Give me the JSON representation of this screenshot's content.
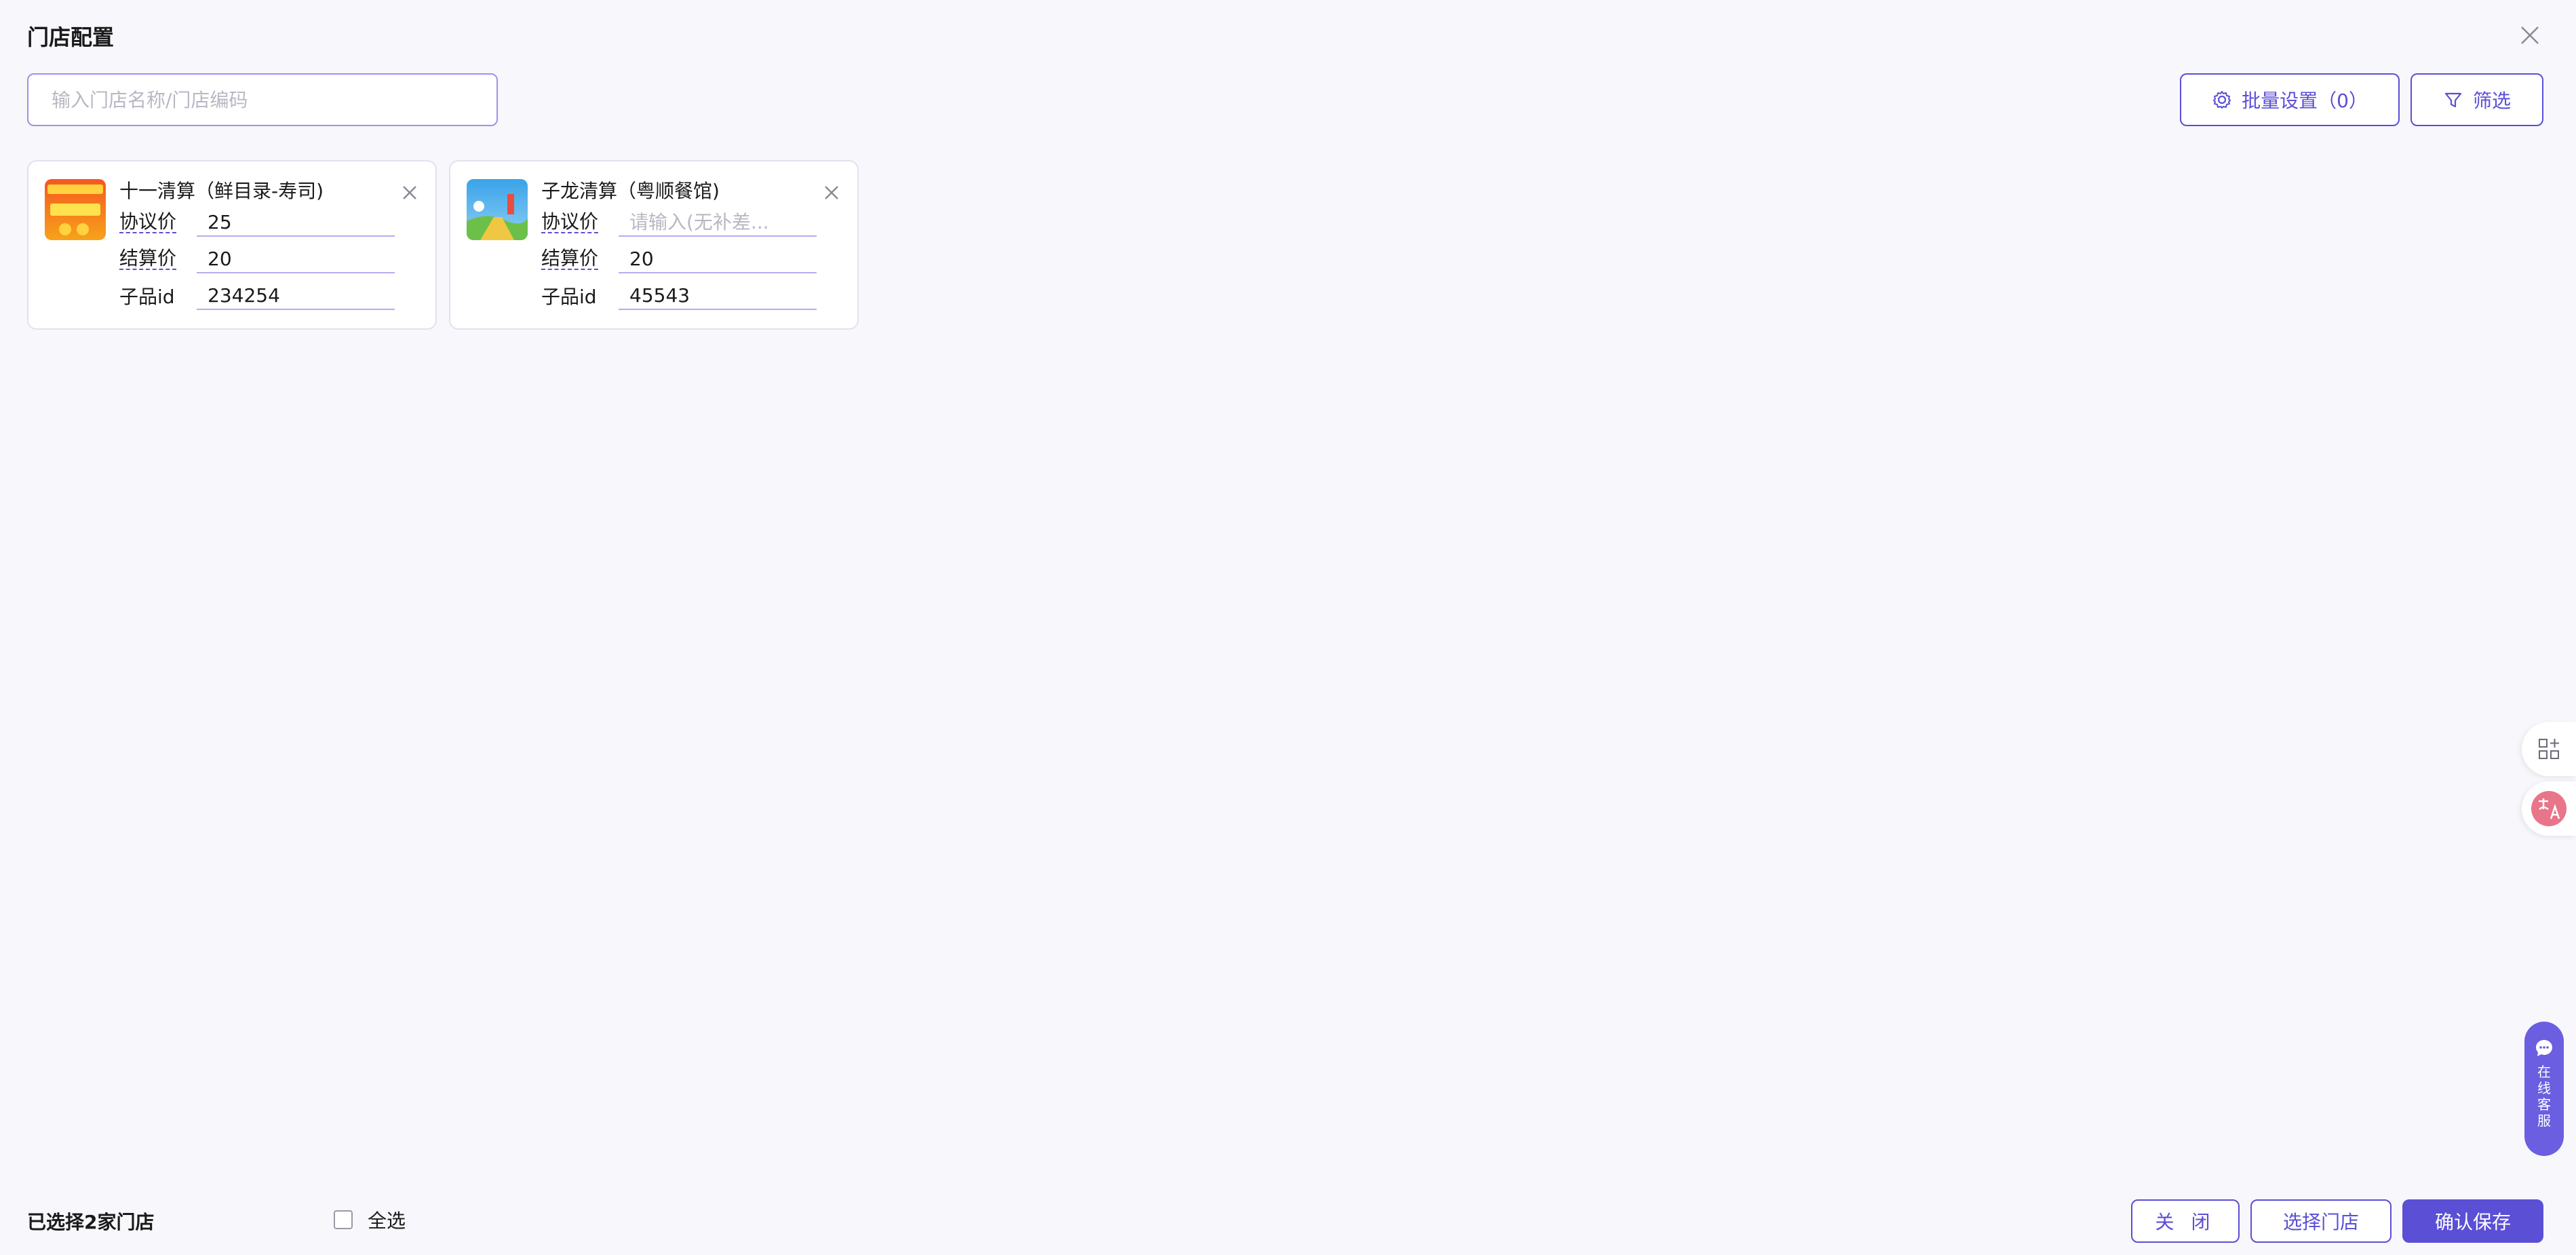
{
  "dialog": {
    "title": "门店配置"
  },
  "search": {
    "placeholder": "输入门店名称/门店编码"
  },
  "toolbar": {
    "batch_label": "批量设置（0）",
    "filter_label": "筛选"
  },
  "cards": [
    {
      "name": "十一清算（鲜目录-寿司)",
      "agreement_label": "协议价",
      "agreement_value": "25",
      "agreement_placeholder": "",
      "settlement_label": "结算价",
      "settlement_value": "20",
      "subid_label": "子品id",
      "subid_value": "234254"
    },
    {
      "name": "子龙清算（粤顺餐馆)",
      "agreement_label": "协议价",
      "agreement_value": "",
      "agreement_placeholder": "请输入(无补差...",
      "settlement_label": "结算价",
      "settlement_value": "20",
      "subid_label": "子品id",
      "subid_value": "45543"
    }
  ],
  "floating": {
    "service_label": "在线客服"
  },
  "footer": {
    "selected_text": "已选择2家门店",
    "select_all_label": "全选",
    "close_label": "关 闭",
    "choose_label": "选择门店",
    "save_label": "确认保存"
  },
  "colors": {
    "accent": "#5b4fd6",
    "background": "#f7f7fc"
  }
}
